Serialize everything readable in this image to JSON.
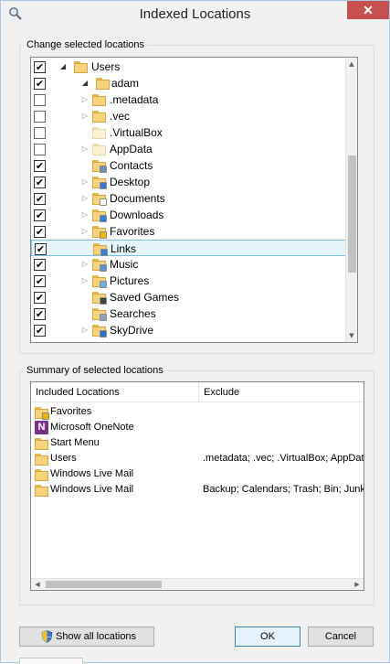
{
  "window": {
    "title": "Indexed Locations",
    "close_glyph": "✕",
    "icon": "search-index-icon"
  },
  "change_group": {
    "legend": "Change selected locations",
    "items": [
      {
        "label": "Users",
        "checked": true,
        "expander": "open",
        "depth": 0,
        "icon": "folder-icon"
      },
      {
        "label": "adam",
        "checked": true,
        "expander": "open",
        "depth": 1,
        "icon": "folder-icon"
      },
      {
        "label": ".metadata",
        "checked": false,
        "expander": "closed",
        "depth": 2,
        "icon": "folder-icon"
      },
      {
        "label": ".vec",
        "checked": false,
        "expander": "closed",
        "depth": 2,
        "icon": "folder-icon"
      },
      {
        "label": ".VirtualBox",
        "checked": false,
        "expander": "none",
        "depth": 2,
        "icon": "folder-faint-icon"
      },
      {
        "label": "AppData",
        "checked": false,
        "expander": "closed",
        "depth": 2,
        "icon": "folder-faint-icon"
      },
      {
        "label": "Contacts",
        "checked": true,
        "expander": "none",
        "depth": 2,
        "icon": "contacts-folder-icon"
      },
      {
        "label": "Desktop",
        "checked": true,
        "expander": "closed",
        "depth": 2,
        "icon": "desktop-folder-icon"
      },
      {
        "label": "Documents",
        "checked": true,
        "expander": "closed",
        "depth": 2,
        "icon": "documents-folder-icon"
      },
      {
        "label": "Downloads",
        "checked": true,
        "expander": "closed",
        "depth": 2,
        "icon": "downloads-folder-icon"
      },
      {
        "label": "Favorites",
        "checked": true,
        "expander": "closed",
        "depth": 2,
        "icon": "favorites-folder-icon"
      },
      {
        "label": "Links",
        "checked": true,
        "expander": "none",
        "depth": 2,
        "icon": "links-folder-icon",
        "selected": true
      },
      {
        "label": "Music",
        "checked": true,
        "expander": "closed",
        "depth": 2,
        "icon": "music-folder-icon"
      },
      {
        "label": "Pictures",
        "checked": true,
        "expander": "closed",
        "depth": 2,
        "icon": "pictures-folder-icon"
      },
      {
        "label": "Saved Games",
        "checked": true,
        "expander": "none",
        "depth": 2,
        "icon": "saved-games-folder-icon"
      },
      {
        "label": "Searches",
        "checked": true,
        "expander": "none",
        "depth": 2,
        "icon": "searches-folder-icon"
      },
      {
        "label": "SkyDrive",
        "checked": true,
        "expander": "closed",
        "depth": 2,
        "icon": "skydrive-folder-icon"
      }
    ],
    "check_glyph": "✔",
    "expander_open_glyph": "◢",
    "expander_closed_glyph": "▷",
    "scroll_up_glyph": "▲",
    "scroll_down_glyph": "▼"
  },
  "summary_group": {
    "legend": "Summary of selected locations",
    "columns": [
      "Included Locations",
      "Exclude"
    ],
    "rows": [
      {
        "location": "Favorites",
        "exclude": "",
        "icon": "favorites-folder-icon"
      },
      {
        "location": "Microsoft OneNote",
        "exclude": "",
        "icon": "onenote-icon"
      },
      {
        "location": "Start Menu",
        "exclude": "",
        "icon": "folder-icon"
      },
      {
        "location": "Users",
        "exclude": ".metadata; .vec; .VirtualBox; AppData",
        "icon": "folder-icon"
      },
      {
        "location": "Windows Live Mail",
        "exclude": "",
        "icon": "folder-icon"
      },
      {
        "location": "Windows Live Mail",
        "exclude": "Backup; Calendars; Trash; Bin; Junk",
        "icon": "folder-icon"
      }
    ],
    "onenote_glyph": "N",
    "scroll_left_glyph": "◀",
    "scroll_right_glyph": "▶"
  },
  "buttons": {
    "show_all": "Show all locations",
    "ok": "OK",
    "cancel": "Cancel"
  },
  "colors": {
    "selection_fill": "#e5f3fb",
    "selection_border": "#7dc0e8",
    "close_button": "#c75050",
    "folder": "#f6d27a"
  }
}
